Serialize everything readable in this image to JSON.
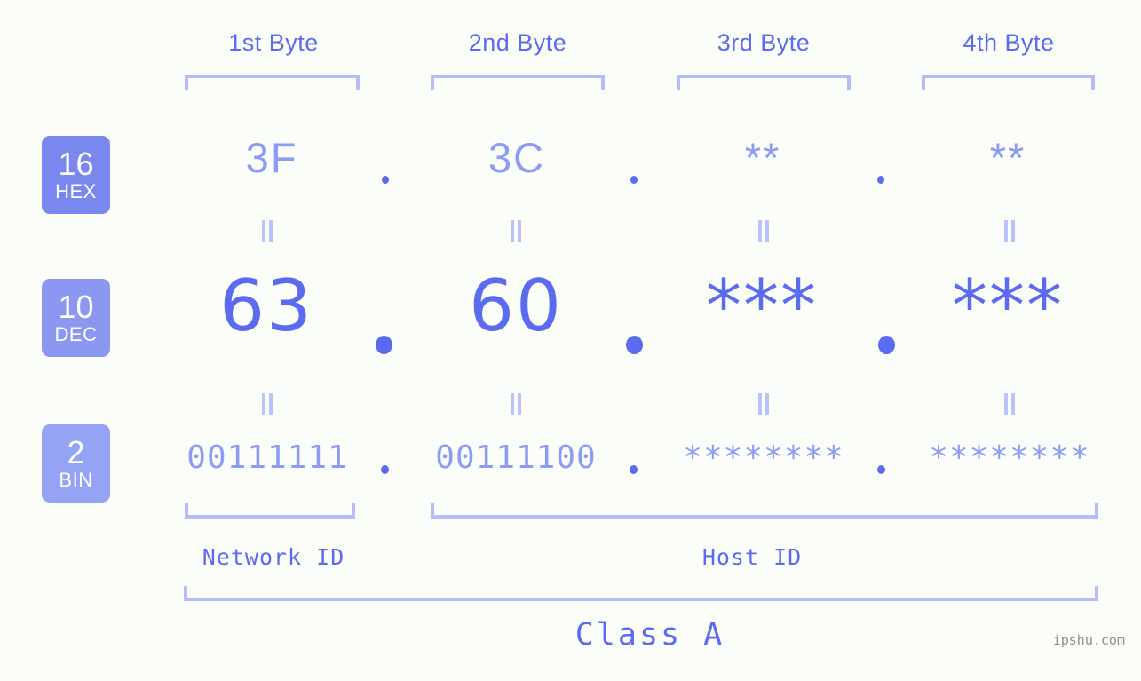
{
  "page": {
    "background_color": "#fbfdf8",
    "accent_color": "#5b6bf0",
    "accent_light_color": "#8e9bf4",
    "bracket_color": "#b3bdfb",
    "watermark": "ipshu.com"
  },
  "byte_headers": [
    {
      "label": "1st Byte"
    },
    {
      "label": "2nd Byte"
    },
    {
      "label": "3rd Byte"
    },
    {
      "label": "4th Byte"
    }
  ],
  "radix_rows": [
    {
      "badge_number": "16",
      "badge_abbr": "HEX",
      "badge_color": "#7a87ee",
      "values": [
        "3F",
        "3C",
        "**",
        "**"
      ],
      "separator": "."
    },
    {
      "badge_number": "10",
      "badge_abbr": "DEC",
      "badge_color": "#8c97f2",
      "values": [
        "63",
        "60",
        "***",
        "***"
      ],
      "separator": "."
    },
    {
      "badge_number": "2",
      "badge_abbr": "BIN",
      "badge_color": "#94a3f4",
      "values": [
        "00111111",
        "00111100",
        "********",
        "********"
      ],
      "separator": "."
    }
  ],
  "equals_marker": "||",
  "sections": [
    {
      "label": "Network ID"
    },
    {
      "label": "Host ID"
    }
  ],
  "class": {
    "label": "Class A"
  }
}
